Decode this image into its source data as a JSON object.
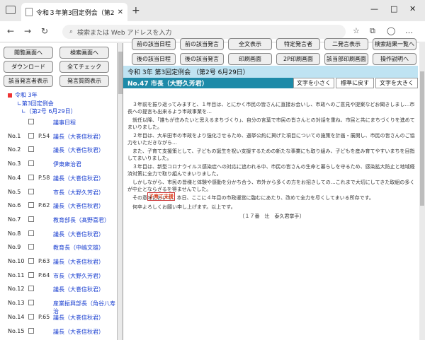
{
  "browser": {
    "tab_title": "令和３年第3回定例会（第2号 6月",
    "address_placeholder": "検索または Web アドレスを入力",
    "new_tab_label": "+",
    "min": "—",
    "max": "□",
    "close": "✕",
    "tab_close": "✕"
  },
  "left_buttons": {
    "prev_screen": "閲覧画面へ",
    "search_screen": "検索画面へ",
    "download": "ダウンロード",
    "check_all": "全てチェック",
    "show_speakers": "該当発言者表示",
    "speaker_list": "発言質問表示"
  },
  "tree": {
    "root": "令和 3年",
    "session": "第3回定例会",
    "issue": "（第2号 6月29日）"
  },
  "rows": [
    {
      "no": "",
      "page": "",
      "name": "議事日程"
    },
    {
      "no": "No.1",
      "page": "P.54",
      "name": "議長（大巻信秋君）"
    },
    {
      "no": "No.2",
      "page": "",
      "name": "議長（大巻信秋君）"
    },
    {
      "no": "No.3",
      "page": "",
      "name": "伊東衆治君"
    },
    {
      "no": "No.4",
      "page": "P.58",
      "name": "議長（大巻信秋君）"
    },
    {
      "no": "No.5",
      "page": "",
      "name": "市長（大野久芳君）"
    },
    {
      "no": "No.6",
      "page": "P.62",
      "name": "議長（大巻信秋君）"
    },
    {
      "no": "No.7",
      "page": "",
      "name": "教育部長（髙野喜君）"
    },
    {
      "no": "No.8",
      "page": "",
      "name": "議長（大巻信秋君）"
    },
    {
      "no": "No.9",
      "page": "",
      "name": "教育長（中嶋文雄）"
    },
    {
      "no": "No.10",
      "page": "P.63",
      "name": "議長（大巻信秋君）"
    },
    {
      "no": "No.11",
      "page": "P.64",
      "name": "市長（大野久芳君）"
    },
    {
      "no": "No.12",
      "page": "",
      "name": "議長（大巻信秋君）"
    },
    {
      "no": "No.13",
      "page": "",
      "name": "産業振興部長（角谷八寿治"
    },
    {
      "no": "No.14",
      "page": "P.65",
      "name": "議長（大巻信秋君）"
    },
    {
      "no": "No.15",
      "page": "",
      "name": "議長（大巻信秋君）"
    }
  ],
  "right_buttons": {
    "prev_schedule": "前の該当日程",
    "prev_speech": "前の該当発言",
    "full_text": "全文表示",
    "specific_speaker": "特定発言者",
    "two_screen": "二発言表示",
    "search_list": "検索結果一覧へ",
    "next_schedule": "後の該当日程",
    "next_speech": "後の該当発言",
    "print_screen": "印刷画面",
    "print_2p": "2P印刷画面",
    "print_all": "該当部印刷画面",
    "help": "操作説明へ"
  },
  "header": {
    "session_title": "令和 3年 第3回定例会 （第2号 6月29日）",
    "speech_title": "No.47 市長（大野久芳君）",
    "smaller": "文字を小さく",
    "standard": "標準に戻す",
    "larger": "文字を大きく"
  },
  "speech": {
    "speaker_tag": "子育て支援",
    "paragraphs": [
      "　３年前を振り返ってみますと、１年目は、とにかく市民の皆さんに直接お会いし、市政へのご意見や提案などお聞きしまし…市長への提言も出来るよう市政事業を…",
      "　就任以降、「誰もが住みたいと思えるまちづくり」、自分の言葉で市民の皆さんとの対話を重ね、市民と共にまちづくりを進めてまいりました。",
      "　２年目は、大牟田市の市政をより強化させるため、選挙公約に掲げた項目についての施策を計画・展開し、市民の皆さんのご協力をいただきながら…",
      "　また、子育て支援策として、子どもの誕生を祝い支援するための新たな事業にも取り組み、子どもを産み育てやすいまちを目指してまいりました。",
      "　３年目は、新型コロナウイルス感染症への対応に追われる中、市民の皆さんの生命と暮らしを守るため、感染拡大防止と地域経済対策に全力で取り組んでまいりました。",
      "　しかしながら、市民の皆様と体験や感動を分かち合う、市外から多くの方をお招きしての…これまで大切にしてきた取組の多くが中止とならざるを得ませんでした。",
      "　その意味において、本日、ここに４年目の市政運営に臨むにあたり、改めて全力を尽くしてまいる所存です。",
      "　何卒よろしくお願い申し上げます。以上です。"
    ],
    "footer": "〔１７番　辻　泰久君挙手〕"
  }
}
